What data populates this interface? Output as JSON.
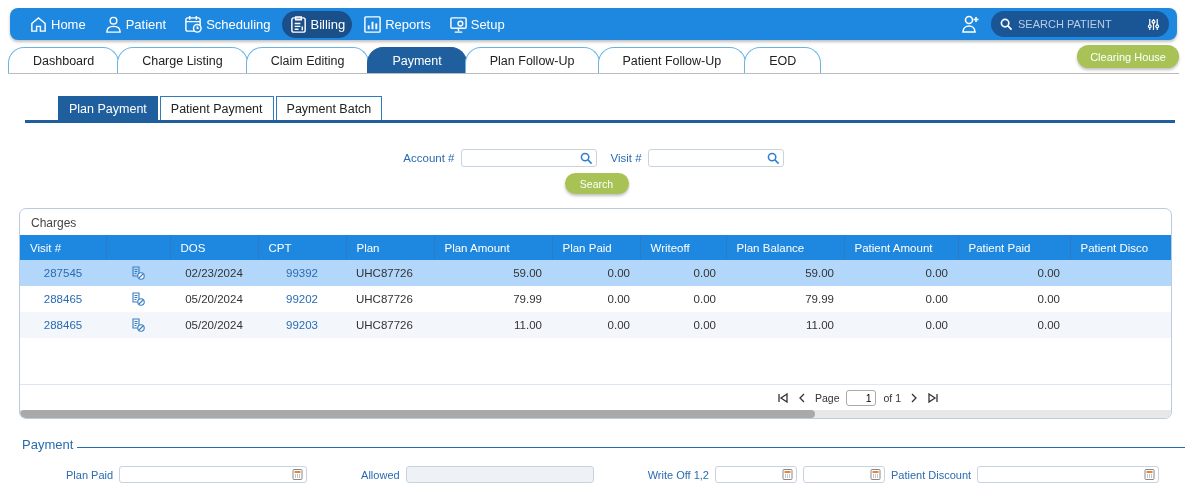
{
  "nav": {
    "items": [
      {
        "label": "Home",
        "selected": false
      },
      {
        "label": "Patient",
        "selected": false
      },
      {
        "label": "Scheduling",
        "selected": false
      },
      {
        "label": "Billing",
        "selected": true
      },
      {
        "label": "Reports",
        "selected": false
      },
      {
        "label": "Setup",
        "selected": false
      }
    ],
    "search": {
      "placeholder": "SEARCH PATIENT"
    }
  },
  "module_tabs": [
    {
      "label": "Dashboard",
      "selected": false
    },
    {
      "label": "Charge Listing",
      "selected": false
    },
    {
      "label": "Claim Editing",
      "selected": false
    },
    {
      "label": "Payment",
      "selected": true
    },
    {
      "label": "Plan Follow-Up",
      "selected": false
    },
    {
      "label": "Patient Follow-Up",
      "selected": false
    },
    {
      "label": "EOD",
      "selected": false
    }
  ],
  "clearing_house_button": "Clearing House",
  "sub_tabs": [
    {
      "label": "Plan Payment",
      "selected": true
    },
    {
      "label": "Patient Payment",
      "selected": false
    },
    {
      "label": "Payment Batch",
      "selected": false
    }
  ],
  "search_form": {
    "fields": [
      {
        "label": "Account #"
      },
      {
        "label": "Visit #"
      }
    ],
    "button": "Search"
  },
  "charges": {
    "title": "Charges",
    "columns": [
      "Visit #",
      "",
      "DOS",
      "CPT",
      "Plan",
      "Plan Amount",
      "Plan Paid",
      "Writeoff",
      "Plan Balance",
      "Patient Amount",
      "Patient Paid",
      "Patient Disco"
    ],
    "rows": [
      {
        "selected": true,
        "cells": [
          "287545",
          "",
          "02/23/2024",
          "99392",
          "UHC87726",
          "59.00",
          "0.00",
          "0.00",
          "59.00",
          "0.00",
          "0.00"
        ]
      },
      {
        "selected": false,
        "cells": [
          "288465",
          "",
          "05/20/2024",
          "99202",
          "UHC87726",
          "79.99",
          "0.00",
          "0.00",
          "79.99",
          "0.00",
          "0.00"
        ]
      },
      {
        "selected": false,
        "cells": [
          "288465",
          "",
          "05/20/2024",
          "99203",
          "UHC87726",
          "11.00",
          "0.00",
          "0.00",
          "11.00",
          "0.00",
          "0.00"
        ]
      }
    ],
    "pager": {
      "page_label": "Page",
      "page": "1",
      "of_label": "of 1"
    }
  },
  "payment": {
    "title": "Payment",
    "fields": [
      {
        "label": "Plan Paid",
        "kind": "calc"
      },
      {
        "label": "Allowed",
        "kind": "readonly"
      },
      {
        "label": "Write Off 1,2",
        "kind": "pair"
      },
      {
        "label": "Patient Discount",
        "kind": "calc"
      }
    ]
  }
}
